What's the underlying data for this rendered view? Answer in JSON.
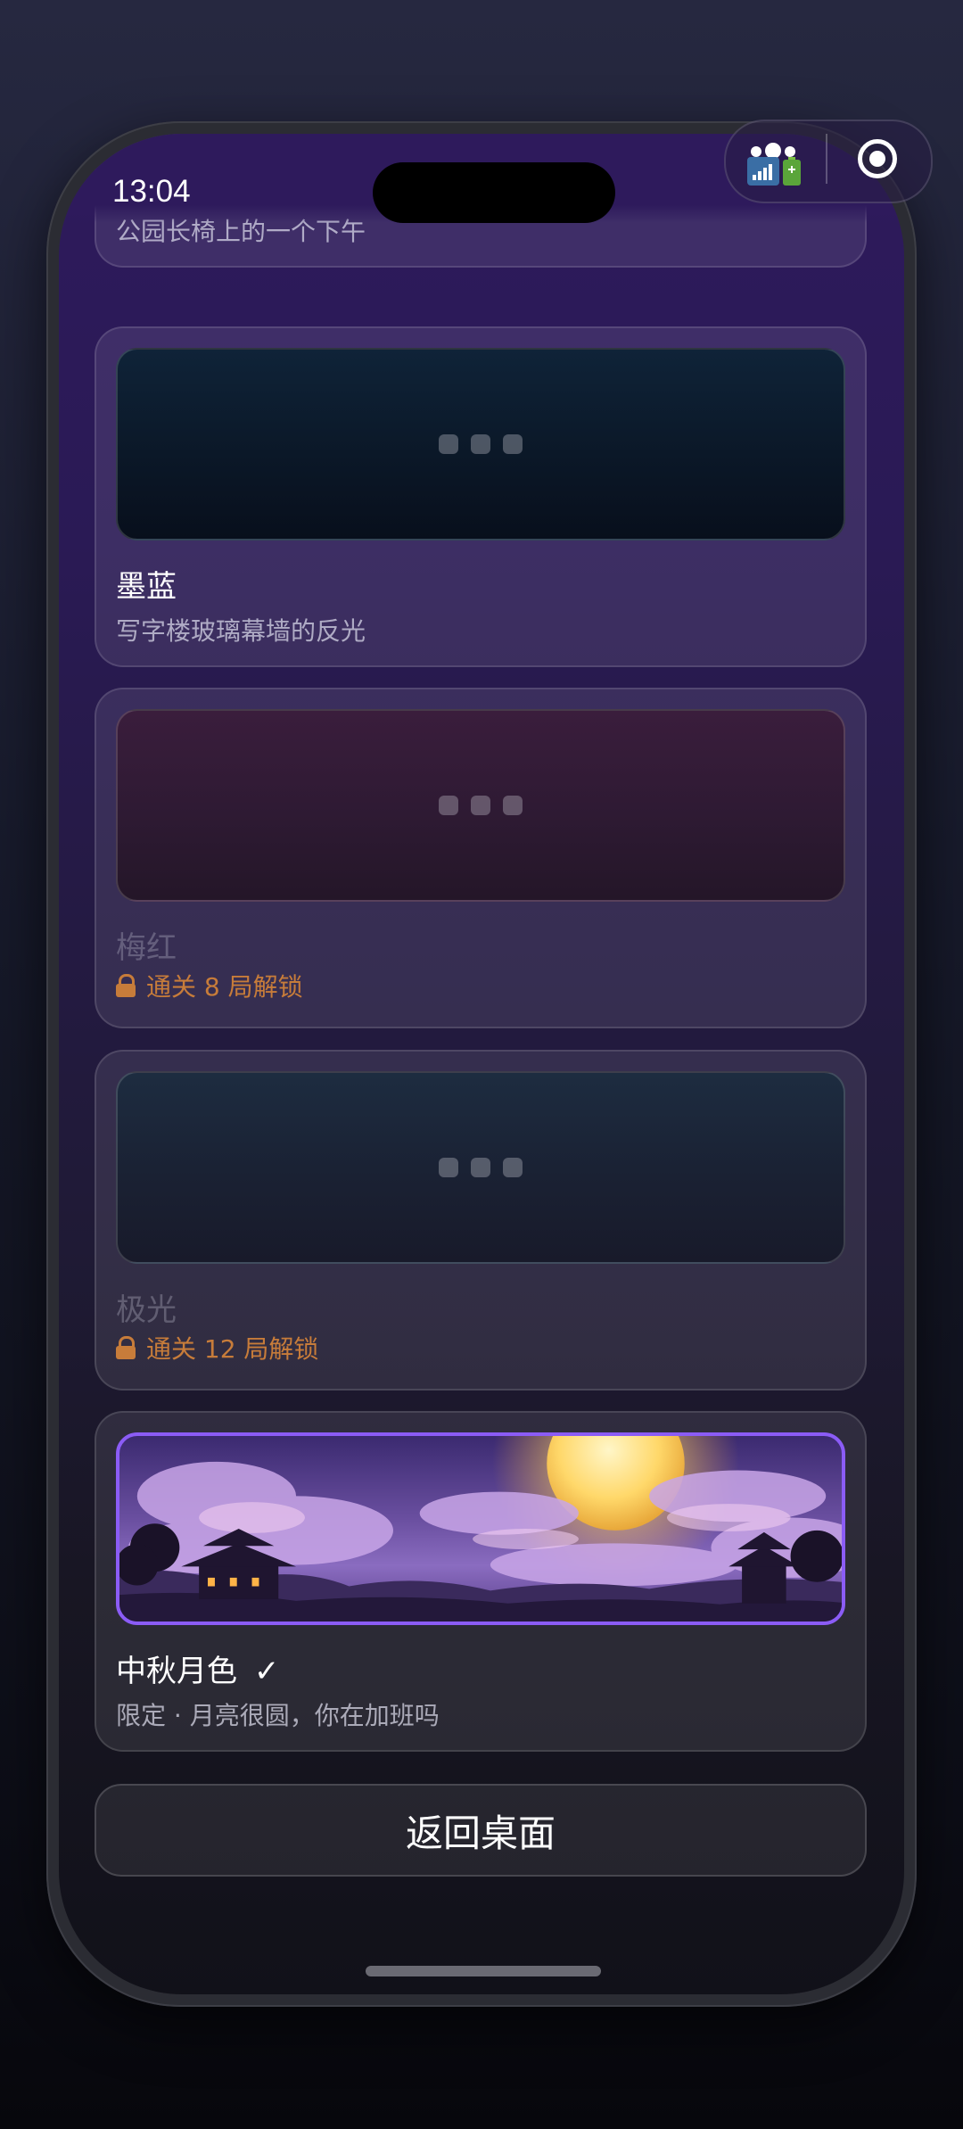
{
  "status": {
    "time": "13:04"
  },
  "themes": [
    {
      "title": "",
      "desc": "公园长椅上的一个下午"
    },
    {
      "title": "墨蓝",
      "desc": "写字楼玻璃幕墙的反光"
    },
    {
      "title": "梅红",
      "lock": "通关 8 局解锁"
    },
    {
      "title": "极光",
      "lock": "通关 12 局解锁"
    },
    {
      "title": "中秋月色",
      "check": "✓",
      "desc": "限定 · 月亮很圆，你在加班吗"
    }
  ],
  "back_button": "返回桌面",
  "colors": {
    "accent": "#8b5cf6",
    "lock": "#c77c3a"
  }
}
